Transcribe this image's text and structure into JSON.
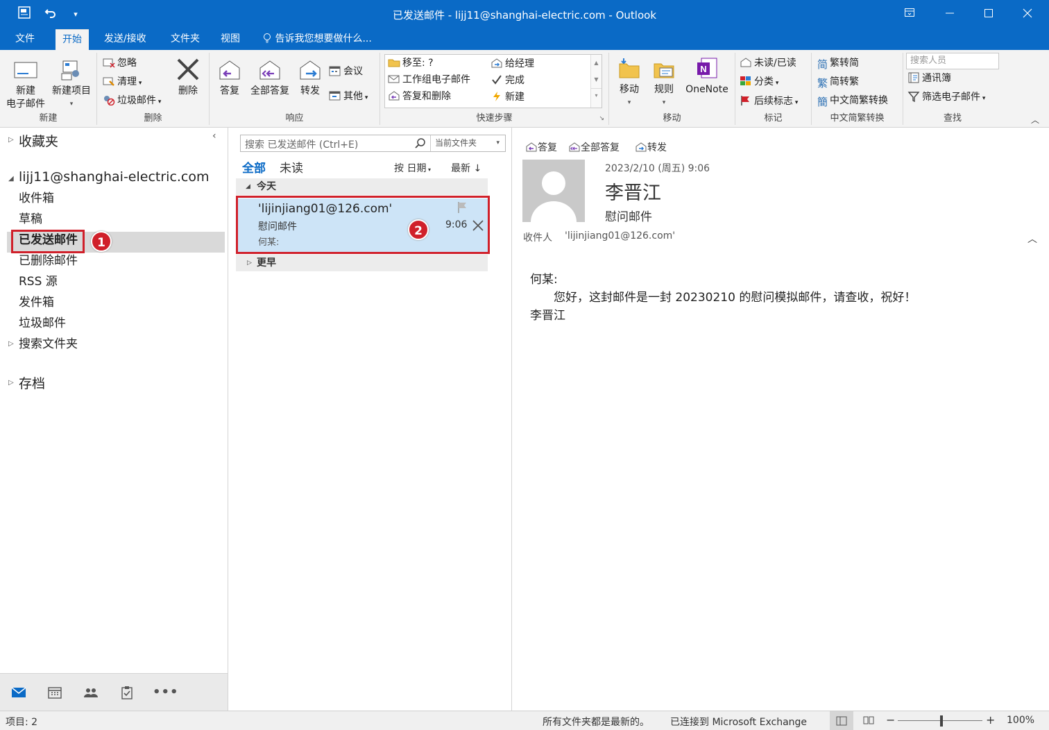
{
  "window": {
    "title": "已发送邮件 - lijj11@shanghai-electric.com - Outlook"
  },
  "menu_tabs": [
    "文件",
    "开始",
    "发送/接收",
    "文件夹",
    "视图"
  ],
  "tell_me": "告诉我您想要做什么...",
  "ribbon": {
    "new": {
      "new_email": "新建\n电子邮件",
      "new_email_l1": "新建",
      "new_email_l2": "电子邮件",
      "new_items": "新建项目",
      "label": "新建"
    },
    "delete": {
      "ignore": "忽略",
      "clean": "清理",
      "junk": "垃圾邮件",
      "delete": "删除",
      "label": "删除"
    },
    "respond": {
      "reply": "答复",
      "reply_all": "全部答复",
      "forward": "转发",
      "meeting": "会议",
      "more": "其他",
      "label": "响应"
    },
    "quick_steps": {
      "move_to": "移至: ?",
      "team_email": "工作组电子邮件",
      "reply_delete": "答复和删除",
      "to_manager": "给经理",
      "done": "完成",
      "create_new": "新建",
      "label": "快速步骤"
    },
    "move": {
      "move": "移动",
      "rules": "规则",
      "onenote": "OneNote",
      "label": "移动"
    },
    "tags": {
      "unread_read": "未读/已读",
      "categorize": "分类",
      "follow_up": "后续标志",
      "label": "标记"
    },
    "chinese": {
      "trad_to_simp": "繁转简",
      "simp_to_trad": "简转繁",
      "conversion": "中文简繁转换",
      "label": "中文简繁转换"
    },
    "find": {
      "search_people_placeholder": "搜索人员",
      "address_book": "通讯簿",
      "filter_email": "筛选电子邮件",
      "label": "查找"
    }
  },
  "nav": {
    "favorites": "收藏夹",
    "account": "lijj11@shanghai-electric.com",
    "folders": [
      "收件箱",
      "草稿",
      "已发送邮件",
      "已删除邮件",
      "RSS 源",
      "发件箱",
      "垃圾邮件",
      "搜索文件夹"
    ],
    "archive": "存档",
    "callout_1": "1"
  },
  "list": {
    "search_placeholder": "搜索 已发送邮件 (Ctrl+E)",
    "search_scope": "当前文件夹",
    "filter_all": "全部",
    "filter_unread": "未读",
    "sort_by": "按 日期",
    "sort_order": "最新",
    "group_today": "今天",
    "group_earlier": "更早",
    "callout_2": "2",
    "items": [
      {
        "to": "'lijinjiang01@126.com'",
        "subject": "慰问邮件",
        "preview": "何某:",
        "time": "9:06"
      }
    ]
  },
  "reading": {
    "reply": "答复",
    "reply_all": "全部答复",
    "forward": "转发",
    "date": "2023/2/10 (周五) 9:06",
    "sender": "李晋江",
    "subject": "慰问邮件",
    "to_label": "收件人",
    "to_value": "'lijinjiang01@126.com'",
    "body_line1": "何某:",
    "body_line2": "您好，这封邮件是一封 20230210 的慰问模拟邮件，请查收，祝好！",
    "body_line3": "李晋江"
  },
  "status": {
    "items_count": "项目: 2",
    "sync": "所有文件夹都是最新的。",
    "connection": "已连接到 Microsoft Exchange",
    "zoom": "100%",
    "zoom_level": 1.0
  },
  "colors": {
    "accent": "#0a6ac6",
    "selection": "#cde4f7",
    "callout": "#d0202a"
  }
}
